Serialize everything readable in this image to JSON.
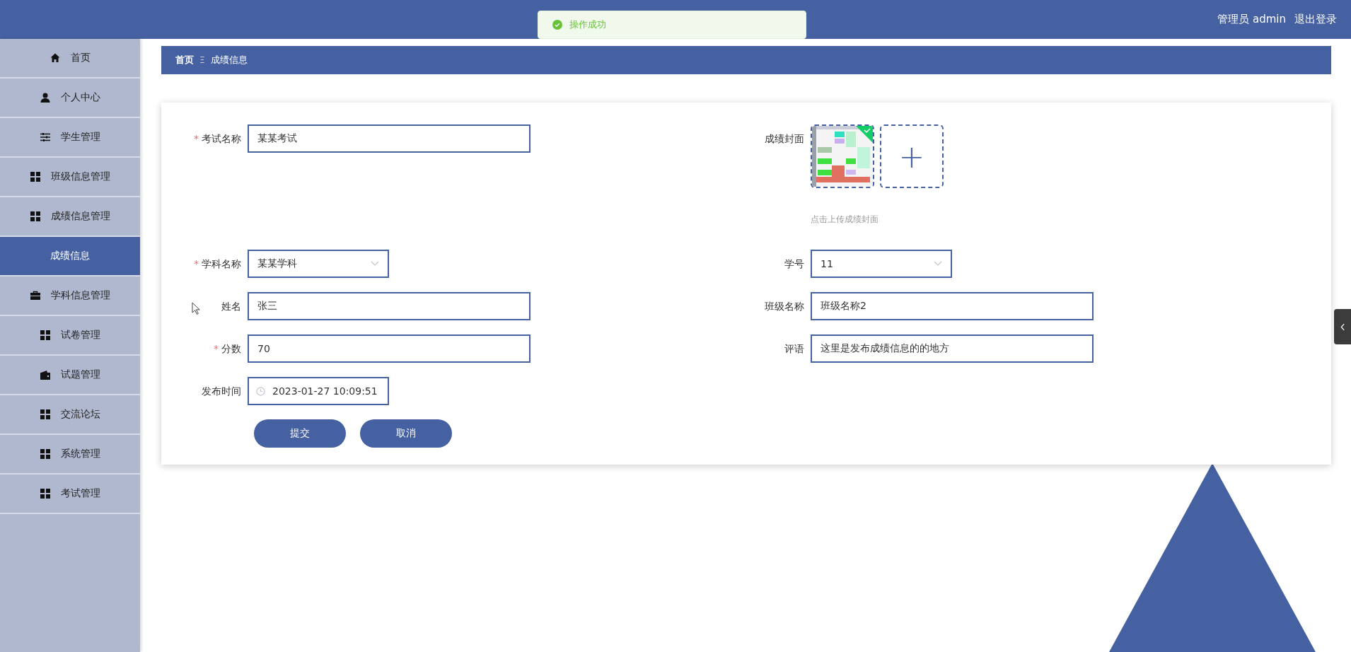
{
  "header": {
    "user": "管理员 admin",
    "logout": "退出登录"
  },
  "toast": {
    "message": "操作成功"
  },
  "sidebar": {
    "items": [
      {
        "label": "首页",
        "kind": "home",
        "selected": false
      },
      {
        "label": "个人中心",
        "kind": "user",
        "selected": false
      },
      {
        "label": "学生管理",
        "kind": "sliders",
        "selected": false
      },
      {
        "label": "班级信息管理",
        "kind": "grid",
        "selected": false
      },
      {
        "label": "成绩信息管理",
        "kind": "grid",
        "selected": false
      },
      {
        "label": "成绩信息",
        "kind": "none",
        "selected": true
      },
      {
        "label": "学科信息管理",
        "kind": "briefcase",
        "selected": false
      },
      {
        "label": "试卷管理",
        "kind": "grid",
        "selected": false
      },
      {
        "label": "试题管理",
        "kind": "wallet",
        "selected": false
      },
      {
        "label": "交流论坛",
        "kind": "grid",
        "selected": false
      },
      {
        "label": "系统管理",
        "kind": "grid",
        "selected": false
      },
      {
        "label": "考试管理",
        "kind": "grid",
        "selected": false
      }
    ]
  },
  "breadcrumb": {
    "items": [
      "首页",
      "成绩信息"
    ],
    "separator": "Ξ"
  },
  "form": {
    "required_mark": "*",
    "rows": [
      [
        {
          "label": "考试名称",
          "kind": "text",
          "required": true,
          "value": "某某考试"
        },
        {
          "label": "成绩封面",
          "kind": "upload",
          "required": false,
          "hint": "点击上传成绩封面",
          "add": "+"
        }
      ],
      [
        {
          "label": "学科名称",
          "kind": "select",
          "required": true,
          "value": "某某学科"
        },
        {
          "label": "学号",
          "kind": "select",
          "required": false,
          "value": "11"
        }
      ],
      [
        {
          "label": "姓名",
          "kind": "text",
          "required": false,
          "value": "张三"
        },
        {
          "label": "班级名称",
          "kind": "text",
          "required": false,
          "value": "班级名称2"
        }
      ],
      [
        {
          "label": "分数",
          "kind": "text",
          "required": true,
          "value": "70"
        },
        {
          "label": "评语",
          "kind": "text",
          "required": false,
          "value": "这里是发布成绩信息的的地方"
        }
      ],
      [
        {
          "label": "发布时间",
          "kind": "date",
          "required": false,
          "value": "2023-01-27 10:09:51"
        }
      ]
    ],
    "buttons": [
      "提交",
      "取消"
    ]
  }
}
